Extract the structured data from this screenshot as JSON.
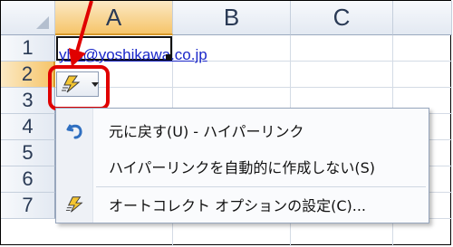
{
  "columns": [
    "A",
    "B",
    "C"
  ],
  "rows": [
    "1",
    "2",
    "3",
    "4",
    "5",
    "6",
    "7"
  ],
  "cell_A1": {
    "value": "yhs@yoshikawa.co.jp"
  },
  "autocorrect_button": {
    "icon": "lightning-bolt-icon",
    "caret": "chevron-down-icon"
  },
  "menu": {
    "items": [
      {
        "icon": "undo-icon",
        "label": "元に戻す(U) - ハイパーリンク"
      },
      {
        "icon": "",
        "label": "ハイパーリンクを自動的に作成しない(S)"
      },
      {
        "icon": "lightning-bolt-icon",
        "label": "オートコレクト オプションの設定(C)..."
      }
    ]
  },
  "colors": {
    "highlight": "#e00000",
    "hyperlink": "#1a27c9",
    "active_header": "#f6c56a"
  }
}
